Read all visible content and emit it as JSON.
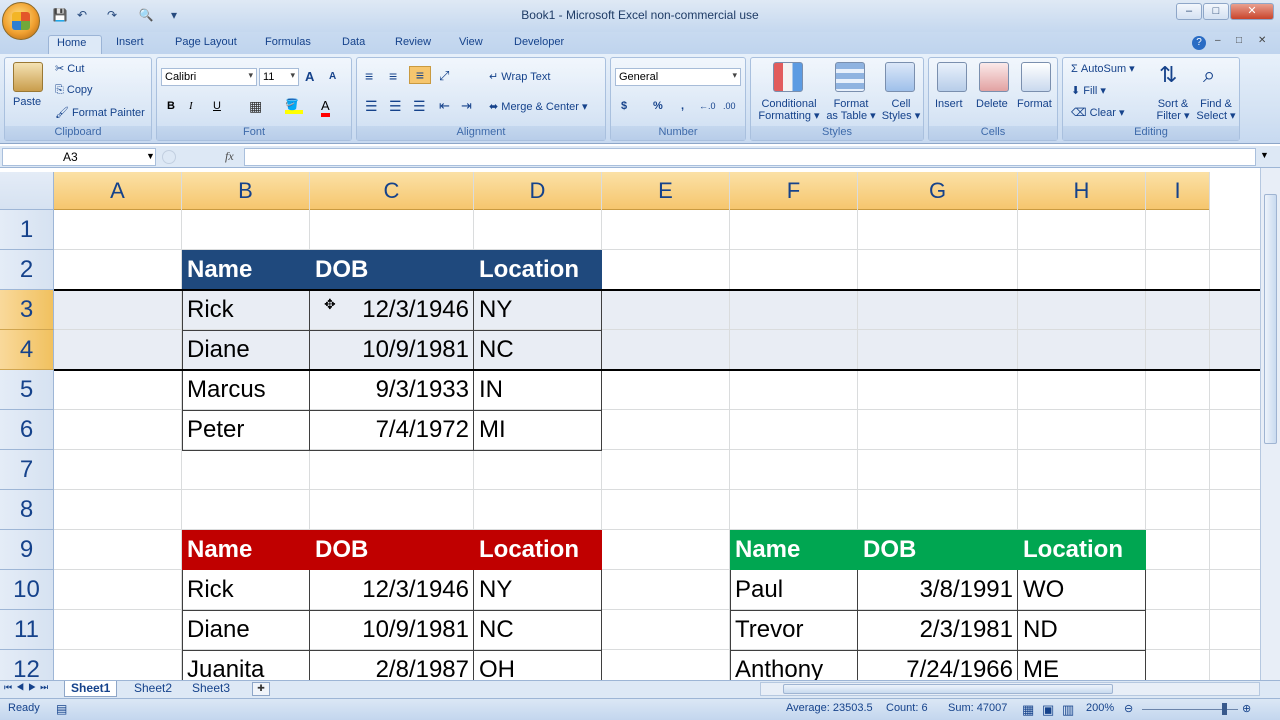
{
  "window": {
    "title": "Book1 - Microsoft Excel non-commercial use",
    "minimize": "–",
    "maximize": "□",
    "close": "✕"
  },
  "ribbon_tabs": [
    "Home",
    "Insert",
    "Page Layout",
    "Formulas",
    "Data",
    "Review",
    "View",
    "Developer"
  ],
  "clipboard": {
    "paste": "Paste",
    "cut": "Cut",
    "copy": "Copy",
    "format_painter": "Format Painter",
    "label": "Clipboard"
  },
  "font": {
    "name": "Calibri",
    "size": "11",
    "bold": "B",
    "italic": "I",
    "underline": "U",
    "grow": "A",
    "shrink": "A",
    "label": "Font"
  },
  "alignment": {
    "wrap": "Wrap Text",
    "merge": "Merge & Center",
    "label": "Alignment"
  },
  "number": {
    "format": "General",
    "currency": "$",
    "percent": "%",
    "comma": ",",
    "inc": "←.0",
    "dec": ".00",
    "label": "Number"
  },
  "styles": {
    "conditional": "Conditional",
    "conditional2": "Formatting",
    "as_table": "Format",
    "as_table2": "as Table",
    "cell": "Cell",
    "cell2": "Styles",
    "label": "Styles"
  },
  "cells": {
    "insert": "Insert",
    "delete": "Delete",
    "format": "Format",
    "label": "Cells"
  },
  "editing": {
    "autosum": "AutoSum",
    "fill": "Fill",
    "clear": "Clear",
    "sort": "Sort &",
    "sort2": "Filter",
    "find": "Find &",
    "find2": "Select",
    "label": "Editing"
  },
  "formula_bar": {
    "name_box": "A3",
    "fx": "fx",
    "value": ""
  },
  "columns": [
    "A",
    "B",
    "C",
    "D",
    "E",
    "F",
    "G",
    "H",
    "I"
  ],
  "rows": [
    "1",
    "2",
    "3",
    "4",
    "5",
    "6",
    "7",
    "8",
    "9",
    "10",
    "11",
    "12"
  ],
  "selected_rows": [
    "3",
    "4"
  ],
  "table_blue": {
    "header": [
      "Name",
      "DOB",
      "Location"
    ],
    "color": "#1f497d",
    "rows": [
      [
        "Rick",
        "12/3/1946",
        "NY"
      ],
      [
        "Diane",
        "10/9/1981",
        "NC"
      ],
      [
        "Marcus",
        "9/3/1933",
        "IN"
      ],
      [
        "Peter",
        "7/4/1972",
        "MI"
      ]
    ]
  },
  "table_red": {
    "header": [
      "Name",
      "DOB",
      "Location"
    ],
    "color": "#c00000",
    "rows": [
      [
        "Rick",
        "12/3/1946",
        "NY"
      ],
      [
        "Diane",
        "10/9/1981",
        "NC"
      ],
      [
        "Juanita",
        "2/8/1987",
        "OH"
      ]
    ]
  },
  "table_green": {
    "header": [
      "Name",
      "DOB",
      "Location"
    ],
    "color": "#00a651",
    "rows": [
      [
        "Paul",
        "3/8/1991",
        "WO"
      ],
      [
        "Trevor",
        "2/3/1981",
        "ND"
      ],
      [
        "Anthony",
        "7/24/1966",
        "ME"
      ]
    ]
  },
  "sheets": [
    "Sheet1",
    "Sheet2",
    "Sheet3"
  ],
  "status": {
    "ready": "Ready",
    "average": "Average: 23503.5",
    "count": "Count: 6",
    "sum": "Sum: 47007",
    "zoom": "200%"
  }
}
